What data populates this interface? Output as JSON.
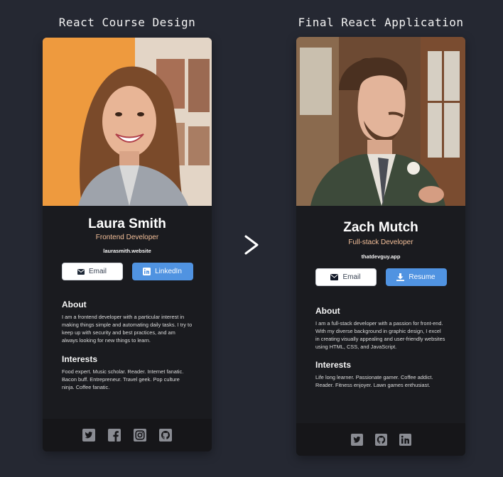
{
  "captions": {
    "left": "React Course Design",
    "right": "Final React Application"
  },
  "cards": [
    {
      "name": "Laura Smith",
      "role": "Frontend Developer",
      "website": "laurasmith.website",
      "buttons": {
        "primary": "Email",
        "secondary": "LinkedIn"
      },
      "about": {
        "heading": "About",
        "text": "I am a frontend developer with a particular interest in making things simple and automating daily tasks. I try to keep up with security and best practices, and am always looking for new things to learn."
      },
      "interests": {
        "heading": "Interests",
        "text": "Food expert. Music scholar. Reader. Internet fanatic. Bacon buff. Entrepreneur. Travel geek. Pop culture ninja. Coffee fanatic."
      },
      "social_icons": [
        "twitter-icon",
        "facebook-icon",
        "instagram-icon",
        "github-icon"
      ]
    },
    {
      "name": "Zach Mutch",
      "role": "Full-stack Developer",
      "website": "thatdevguy.app",
      "buttons": {
        "primary": "Email",
        "secondary": "Resume"
      },
      "about": {
        "heading": "About",
        "text": "I am a full-stack developer with a passion for front-end. With my diverse background in graphic design, I excel in creating visually appealing and user-friendly websites using HTML, CSS, and JavaScript."
      },
      "interests": {
        "heading": "Interests",
        "text": "Life long learner. Passionate gamer. Coffee addict. Reader. Fitness enjoyer. Lawn games enthusiast."
      },
      "social_icons": [
        "twitter-icon",
        "github-icon",
        "linkedin-icon"
      ]
    }
  ],
  "colors": {
    "background": "#252832",
    "card": "#1a1b1f",
    "footer": "#161619",
    "accent_role": "#f3bf99",
    "button_blue": "#5093e1"
  }
}
